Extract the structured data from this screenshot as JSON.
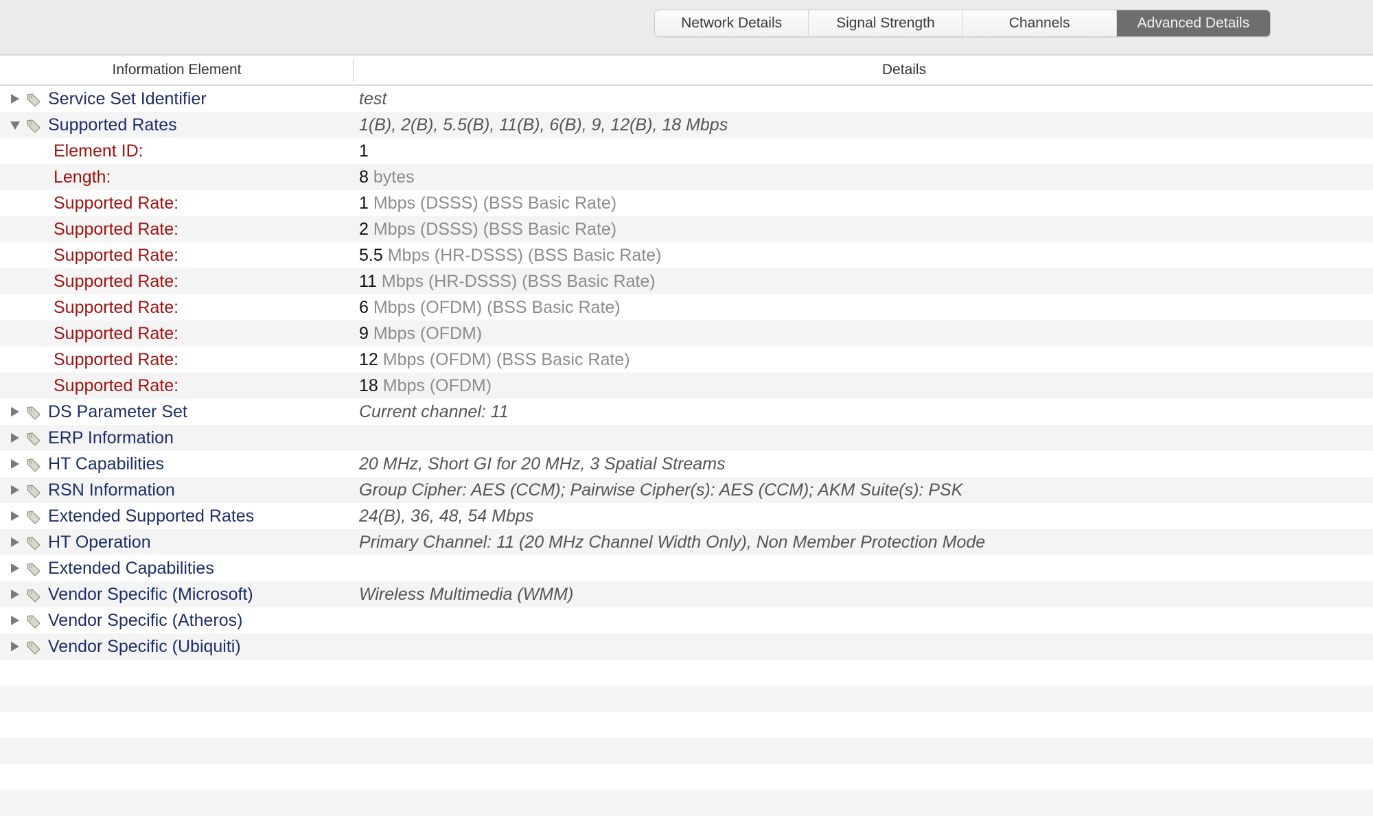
{
  "tabs": [
    {
      "label": "Network Details",
      "active": false
    },
    {
      "label": "Signal Strength",
      "active": false
    },
    {
      "label": "Channels",
      "active": false
    },
    {
      "label": "Advanced Details",
      "active": true
    }
  ],
  "table": {
    "columns": [
      "Information Element",
      "Details"
    ],
    "rows": [
      {
        "type": "element",
        "expanded": false,
        "name": "Service Set Identifier",
        "details": "test"
      },
      {
        "type": "element",
        "expanded": true,
        "name": "Supported Rates",
        "details": "1(B), 2(B), 5.5(B), 11(B), 6(B), 9, 12(B), 18 Mbps"
      },
      {
        "type": "field",
        "name": "Element ID:",
        "value": "1",
        "unit": ""
      },
      {
        "type": "field",
        "name": "Length:",
        "value": "8",
        "unit": " bytes"
      },
      {
        "type": "field",
        "name": "Supported Rate:",
        "value": "1",
        "unit": " Mbps (DSSS) (BSS Basic Rate)"
      },
      {
        "type": "field",
        "name": "Supported Rate:",
        "value": "2",
        "unit": " Mbps (DSSS) (BSS Basic Rate)"
      },
      {
        "type": "field",
        "name": "Supported Rate:",
        "value": "5.5",
        "unit": " Mbps (HR-DSSS) (BSS Basic Rate)"
      },
      {
        "type": "field",
        "name": "Supported Rate:",
        "value": "11",
        "unit": " Mbps (HR-DSSS) (BSS Basic Rate)"
      },
      {
        "type": "field",
        "name": "Supported Rate:",
        "value": "6",
        "unit": " Mbps (OFDM) (BSS Basic Rate)"
      },
      {
        "type": "field",
        "name": "Supported Rate:",
        "value": "9",
        "unit": " Mbps (OFDM)"
      },
      {
        "type": "field",
        "name": "Supported Rate:",
        "value": "12",
        "unit": " Mbps (OFDM) (BSS Basic Rate)"
      },
      {
        "type": "field",
        "name": "Supported Rate:",
        "value": "18",
        "unit": " Mbps (OFDM)"
      },
      {
        "type": "element",
        "expanded": false,
        "name": "DS Parameter Set",
        "details": "Current channel: 11"
      },
      {
        "type": "element",
        "expanded": false,
        "name": "ERP Information",
        "details": ""
      },
      {
        "type": "element",
        "expanded": false,
        "name": "HT Capabilities",
        "details": "20 MHz, Short GI for 20 MHz, 3 Spatial Streams"
      },
      {
        "type": "element",
        "expanded": false,
        "name": "RSN Information",
        "details": "Group Cipher: AES (CCM); Pairwise Cipher(s): AES (CCM); AKM Suite(s): PSK"
      },
      {
        "type": "element",
        "expanded": false,
        "name": "Extended Supported Rates",
        "details": "24(B), 36, 48, 54 Mbps"
      },
      {
        "type": "element",
        "expanded": false,
        "name": "HT Operation",
        "details": "Primary Channel: 11 (20 MHz Channel Width Only), Non Member Protection Mode"
      },
      {
        "type": "element",
        "expanded": false,
        "name": "Extended Capabilities",
        "details": ""
      },
      {
        "type": "element",
        "expanded": false,
        "name": "Vendor Specific (Microsoft)",
        "details": "Wireless Multimedia (WMM)"
      },
      {
        "type": "element",
        "expanded": false,
        "name": "Vendor Specific (Atheros)",
        "details": ""
      },
      {
        "type": "element",
        "expanded": false,
        "name": "Vendor Specific (Ubiquiti)",
        "details": ""
      }
    ]
  },
  "icons": {
    "disclosure": "disclosure-triangle-icon",
    "element": "tag-icon"
  },
  "colors": {
    "element_name": "#1c2d6b",
    "field_label": "#a21212",
    "active_tab": "#6e6e6e"
  }
}
